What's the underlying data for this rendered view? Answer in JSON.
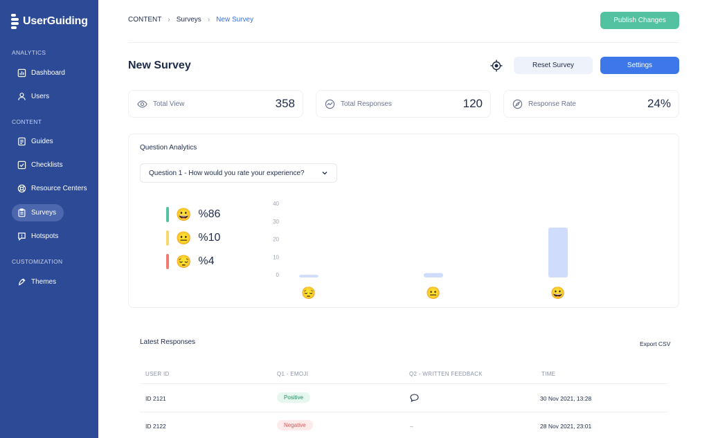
{
  "brand": {
    "name": "UserGuiding"
  },
  "sidebar": {
    "sections": [
      "ANALYTICS",
      "CONTENT",
      "CUSTOMIZATION"
    ],
    "items": [
      {
        "label": "Dashboard",
        "icon": "dashboard-icon"
      },
      {
        "label": "Users",
        "icon": "user-icon"
      },
      {
        "label": "Guides",
        "icon": "guides-icon"
      },
      {
        "label": "Checklists",
        "icon": "checklist-icon"
      },
      {
        "label": "Resource Centers",
        "icon": "lifebuoy-icon"
      },
      {
        "label": "Surveys",
        "icon": "clipboard-icon",
        "active": true
      },
      {
        "label": "Hotspots",
        "icon": "hotspot-icon"
      },
      {
        "label": "Themes",
        "icon": "palette-icon"
      }
    ]
  },
  "breadcrumb": [
    "CONTENT",
    "Surveys",
    "New Survey"
  ],
  "header": {
    "publish_label": "Publish Changes",
    "title": "New Survey",
    "reset_label": "Reset Survey",
    "settings_label": "Settings"
  },
  "stats": [
    {
      "label": "Total View",
      "value": "358",
      "icon": "eye-icon"
    },
    {
      "label": "Total Responses",
      "value": "120",
      "icon": "trend-icon"
    },
    {
      "label": "Response Rate",
      "value": "24%",
      "icon": "compass-icon"
    }
  ],
  "question_analytics": {
    "title": "Question Analytics",
    "selected_question": "Question 1 - How would you rate your experience?",
    "legend": [
      {
        "emoji": "😀",
        "pct": "%86",
        "color": "#53c2a0"
      },
      {
        "emoji": "😐",
        "pct": "%10",
        "color": "#f7d96b"
      },
      {
        "emoji": "😔",
        "pct": "%4",
        "color": "#f07b6e"
      }
    ]
  },
  "chart_data": {
    "type": "bar",
    "categories": [
      "😔",
      "😐",
      "😀"
    ],
    "values": [
      1.5,
      2.5,
      28
    ],
    "ylim": [
      0,
      40
    ],
    "yticks": [
      0,
      10,
      20,
      30,
      40
    ],
    "bar_color": "#cfdcfb"
  },
  "latest_responses": {
    "title": "Latest Responses",
    "export_label": "Export CSV",
    "columns": [
      "USER ID",
      "Q1 - EMOJI",
      "Q2 - WRITTEN FEEDBACK",
      "TIME"
    ],
    "rows": [
      {
        "user_id": "ID 2121",
        "emoji": "Positive",
        "sentiment": "pos",
        "feedback": "",
        "feedback_icon": "comment-icon",
        "time": "30 Nov 2021, 13:28"
      },
      {
        "user_id": "ID 2122",
        "emoji": "Negative",
        "sentiment": "neg",
        "feedback": "–",
        "feedback_icon": "",
        "time": "28 Nov 2021, 23:01"
      }
    ]
  }
}
